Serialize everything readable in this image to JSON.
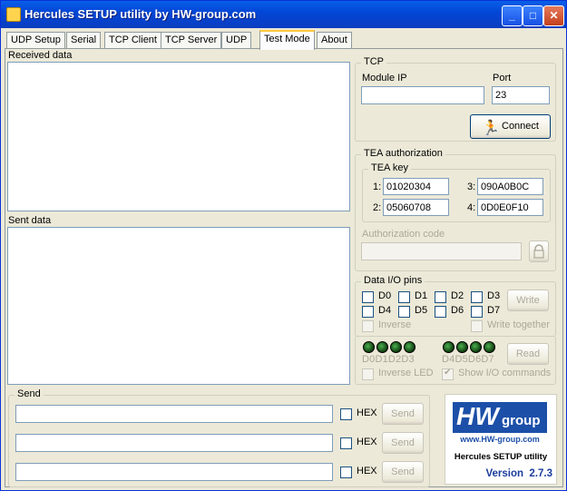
{
  "window": {
    "title": "Hercules SETUP utility by HW-group.com",
    "minimize": "_",
    "maximize": "□",
    "close": "✕"
  },
  "tabs": [
    "UDP Setup",
    "Serial",
    "TCP Client",
    "TCP Server",
    "UDP",
    "Test Mode",
    "About"
  ],
  "active_tab": "Test Mode",
  "received": {
    "label": "Received data"
  },
  "sent": {
    "label": "Sent data"
  },
  "tcp": {
    "title": "TCP",
    "module_ip_label": "Module IP",
    "module_ip": "",
    "port_label": "Port",
    "port": "23",
    "connect_label": "Connect"
  },
  "tea": {
    "title": "TEA authorization",
    "key_title": "TEA key",
    "k1_label": "1:",
    "k1": "01020304",
    "k2_label": "2:",
    "k2": "05060708",
    "k3_label": "3:",
    "k3": "090A0B0C",
    "k4_label": "4:",
    "k4": "0D0E0F10",
    "auth_label": "Authorization code",
    "auth_value": ""
  },
  "dio": {
    "title": "Data I/O pins",
    "pins": [
      "D0",
      "D1",
      "D2",
      "D3",
      "D4",
      "D5",
      "D6",
      "D7"
    ],
    "write_label": "Write",
    "inverse_label": "Inverse",
    "write_together_label": "Write together",
    "led_labels_left": "D0D1D2D3",
    "led_labels_right": "D4D5D6D7",
    "read_label": "Read",
    "inverse_led_label": "Inverse LED",
    "show_io_label": "Show I/O commands"
  },
  "send": {
    "title": "Send",
    "rows": [
      {
        "value": "",
        "hex_label": "HEX",
        "send_label": "Send"
      },
      {
        "value": "",
        "hex_label": "HEX",
        "send_label": "Send"
      },
      {
        "value": "",
        "hex_label": "HEX",
        "send_label": "Send"
      }
    ]
  },
  "logo": {
    "brand_hw": "HW",
    "brand_group": "group",
    "url": "www.HW-group.com",
    "product": "Hercules SETUP utility",
    "version": "Version  2.7.3"
  },
  "colors": {
    "title_blue": "#0247d7",
    "logo_blue": "#1c4fa8",
    "version_blue": "#1a3c9c",
    "tab_highlight": "#ffc83c"
  },
  "icons": {
    "connect": "running-man-icon",
    "lock": "padlock-icon"
  }
}
